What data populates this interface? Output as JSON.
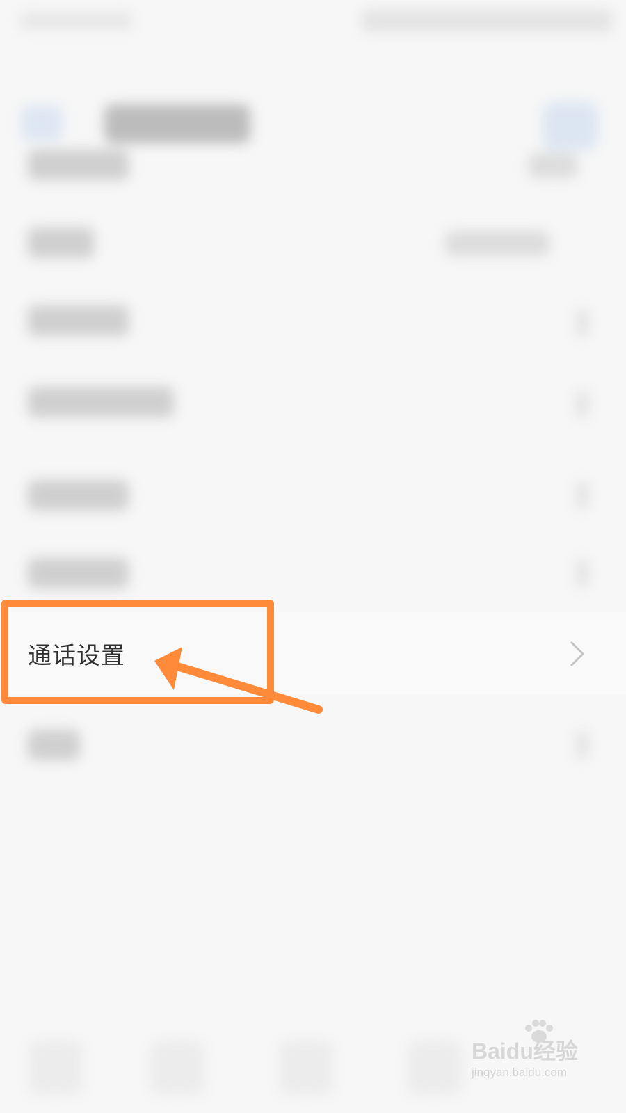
{
  "screen": {
    "call_settings_item": {
      "label": "通话设置",
      "chevron": "chevron-right-icon"
    }
  },
  "annotation": {
    "highlight_color": "#ff8a3a",
    "arrow_color": "#ff8a3a"
  },
  "watermark": {
    "brand": "Baidu经验",
    "url": "jingyan.baidu.com"
  }
}
